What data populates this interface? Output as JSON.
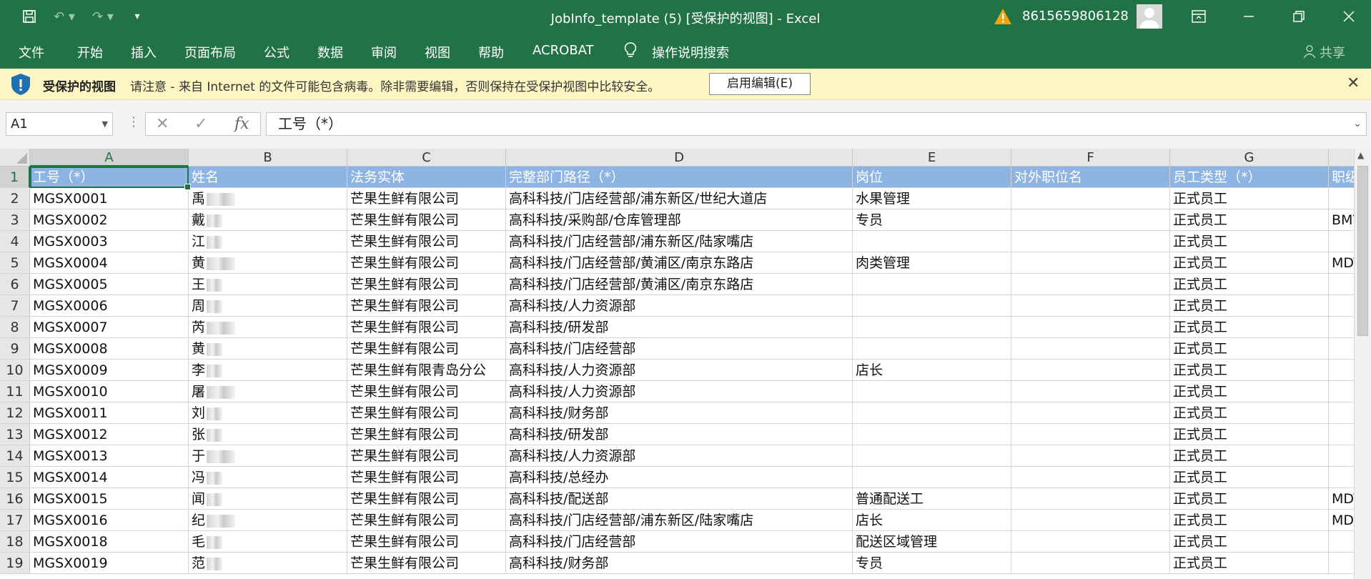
{
  "titlebar": {
    "title": "JobInfo_template (5)  [受保护的视图]  -  Excel",
    "account": "8615659806128",
    "icons": [
      "save-icon",
      "undo-icon",
      "redo-icon",
      "customize-icon",
      "warning-icon",
      "avatar",
      "ribbon-display-icon",
      "minimize-icon",
      "restore-icon",
      "close-icon"
    ]
  },
  "ribbon": {
    "tabs": [
      "文件",
      "开始",
      "插入",
      "页面布局",
      "公式",
      "数据",
      "审阅",
      "视图",
      "帮助",
      "ACROBAT"
    ],
    "tell_me": "操作说明搜索",
    "share": "共享"
  },
  "protected_view": {
    "title": "受保护的视图",
    "message": "请注意 - 来自 Internet 的文件可能包含病毒。除非需要编辑，否则保持在受保护视图中比较安全。",
    "button": "启用编辑(E)"
  },
  "formula_bar": {
    "name_box": "A1",
    "fx": "fx",
    "content": "工号（*）"
  },
  "sheet": {
    "columns": [
      "A",
      "B",
      "C",
      "D",
      "E",
      "F",
      "G"
    ],
    "row_numbers": [
      "1",
      "2",
      "3",
      "4",
      "5",
      "6",
      "7",
      "8",
      "9",
      "10",
      "11",
      "12",
      "13",
      "14",
      "15",
      "16",
      "17",
      "18",
      "19"
    ],
    "header": [
      "工号（*）",
      "姓名",
      "法务实体",
      "完整部门路径（*）",
      "岗位",
      "对外职位名",
      "员工类型（*）",
      "职级"
    ],
    "rows": [
      {
        "id": "MGSX0001",
        "name": "禹",
        "entity": "芒果生鲜有限公司",
        "dept": "高科科技/门店经营部/浦东新区/世纪大道店",
        "post": "水果管理",
        "ext": "",
        "type": "正式员工",
        "level": ""
      },
      {
        "id": "MGSX0002",
        "name": "戴",
        "entity": "芒果生鲜有限公司",
        "dept": "高科科技/采购部/仓库管理部",
        "post": "专员",
        "ext": "",
        "type": "正式员工",
        "level": "BMY"
      },
      {
        "id": "MGSX0003",
        "name": "江",
        "entity": "芒果生鲜有限公司",
        "dept": "高科科技/门店经营部/浦东新区/陆家嘴店",
        "post": "",
        "ext": "",
        "type": "正式员工",
        "level": ""
      },
      {
        "id": "MGSX0004",
        "name": "黄",
        "entity": "芒果生鲜有限公司",
        "dept": "高科科技/门店经营部/黄浦区/南京东路店",
        "post": "肉类管理",
        "ext": "",
        "type": "正式员工",
        "level": "MDY"
      },
      {
        "id": "MGSX0005",
        "name": "王",
        "entity": "芒果生鲜有限公司",
        "dept": "高科科技/门店经营部/黄浦区/南京东路店",
        "post": "",
        "ext": "",
        "type": "正式员工",
        "level": ""
      },
      {
        "id": "MGSX0006",
        "name": "周",
        "entity": "芒果生鲜有限公司",
        "dept": "高科科技/人力资源部",
        "post": "",
        "ext": "",
        "type": "正式员工",
        "level": ""
      },
      {
        "id": "MGSX0007",
        "name": "芮",
        "entity": "芒果生鲜有限公司",
        "dept": "高科科技/研发部",
        "post": "",
        "ext": "",
        "type": "正式员工",
        "level": ""
      },
      {
        "id": "MGSX0008",
        "name": "黄",
        "entity": "芒果生鲜有限公司",
        "dept": "高科科技/门店经营部",
        "post": "",
        "ext": "",
        "type": "正式员工",
        "level": ""
      },
      {
        "id": "MGSX0009",
        "name": "李",
        "entity": "芒果生鲜有限青岛分公",
        "dept": "高科科技/人力资源部",
        "post": "店长",
        "ext": "",
        "type": "正式员工",
        "level": ""
      },
      {
        "id": "MGSX0010",
        "name": "屠",
        "entity": "芒果生鲜有限公司",
        "dept": "高科科技/人力资源部",
        "post": "",
        "ext": "",
        "type": "正式员工",
        "level": ""
      },
      {
        "id": "MGSX0011",
        "name": "刘",
        "entity": "芒果生鲜有限公司",
        "dept": "高科科技/财务部",
        "post": "",
        "ext": "",
        "type": "正式员工",
        "level": ""
      },
      {
        "id": "MGSX0012",
        "name": "张",
        "entity": "芒果生鲜有限公司",
        "dept": "高科科技/研发部",
        "post": "",
        "ext": "",
        "type": "正式员工",
        "level": ""
      },
      {
        "id": "MGSX0013",
        "name": "于",
        "entity": "芒果生鲜有限公司",
        "dept": "高科科技/人力资源部",
        "post": "",
        "ext": "",
        "type": "正式员工",
        "level": ""
      },
      {
        "id": "MGSX0014",
        "name": "冯",
        "entity": "芒果生鲜有限公司",
        "dept": "高科科技/总经办",
        "post": "",
        "ext": "",
        "type": "正式员工",
        "level": ""
      },
      {
        "id": "MGSX0015",
        "name": "闻",
        "entity": "芒果生鲜有限公司",
        "dept": "高科科技/配送部",
        "post": "普通配送工",
        "ext": "",
        "type": "正式员工",
        "level": "MDY"
      },
      {
        "id": "MGSX0016",
        "name": "纪",
        "entity": "芒果生鲜有限公司",
        "dept": "高科科技/门店经营部/浦东新区/陆家嘴店",
        "post": "店长",
        "ext": "",
        "type": "正式员工",
        "level": "MDD"
      },
      {
        "id": "MGSX0018",
        "name": "毛",
        "entity": "芒果生鲜有限公司",
        "dept": "高科科技/门店经营部",
        "post": "配送区域管理",
        "ext": "",
        "type": "正式员工",
        "level": ""
      },
      {
        "id": "MGSX0019",
        "name": "范",
        "entity": "芒果生鲜有限公司",
        "dept": "高科科技/财务部",
        "post": "专员",
        "ext": "",
        "type": "正式员工",
        "level": ""
      }
    ]
  },
  "colors": {
    "brand": "#217346",
    "header_fill": "#8eb4e3",
    "protected_bar": "#fdf6c3"
  }
}
